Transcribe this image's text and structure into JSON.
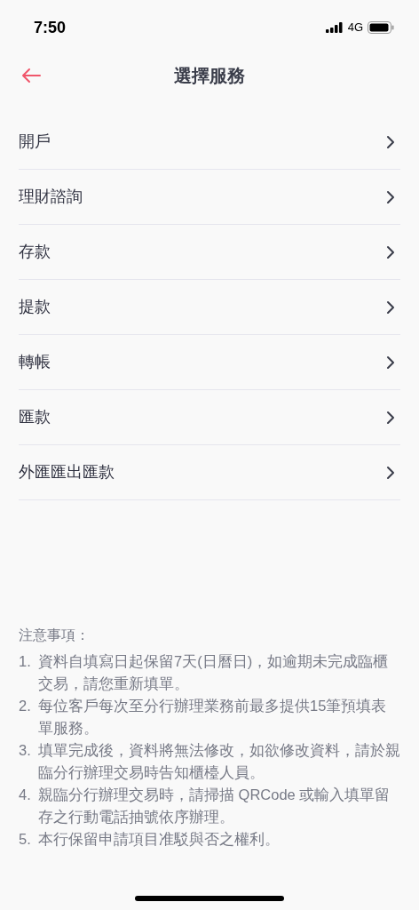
{
  "status_bar": {
    "time": "7:50",
    "network": "4G"
  },
  "header": {
    "title": "選擇服務"
  },
  "services": [
    {
      "label": "開戶"
    },
    {
      "label": "理財諮詢"
    },
    {
      "label": "存款"
    },
    {
      "label": "提款"
    },
    {
      "label": "轉帳"
    },
    {
      "label": "匯款"
    },
    {
      "label": "外匯匯出匯款"
    }
  ],
  "notes": {
    "title": "注意事項：",
    "items": [
      {
        "number": "1.",
        "text": "資料自填寫日起保留7天(日曆日)，如逾期未完成臨櫃交易，請您重新填單。"
      },
      {
        "number": "2.",
        "text": "每位客戶每次至分行辦理業務前最多提供15筆預填表單服務。"
      },
      {
        "number": "3.",
        "text": "填單完成後，資料將無法修改，如欲修改資料，請於親臨分行辦理交易時告知櫃檯人員。"
      },
      {
        "number": "4.",
        "text": "親臨分行辦理交易時，請掃描 QRCode 或輸入填單留存之行動電話抽號依序辦理。"
      },
      {
        "number": "5.",
        "text": "本行保留申請項目准駁與否之權利。"
      }
    ]
  }
}
